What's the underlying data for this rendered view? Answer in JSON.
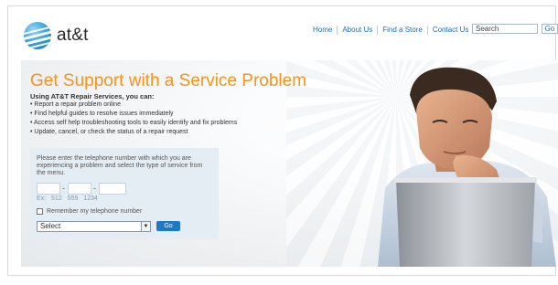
{
  "header": {
    "logo_text": "at&t",
    "nav": [
      "Home",
      "About Us",
      "Find a Store",
      "Contact Us"
    ],
    "search_value": "Search",
    "search_go": "Go"
  },
  "hero": {
    "headline": "Get Support with a Service Problem",
    "subhead": "Using AT&T Repair Services, you can:",
    "bullets": [
      "Report a repair problem online",
      "Find helpful guides to resolve issues immediately",
      "Access self help troubleshooting tools to easily identify and fix problems",
      "Update, cancel, or check the status of a repair request"
    ]
  },
  "form": {
    "instructions": "Please enter the telephone number with which you are experiencing a problem and select the type of service from the menu.",
    "dash": "-",
    "hint": "Ex: 512  555  1234",
    "remember_label": "Remember my telephone number",
    "select_value": "Select",
    "go_label": "Go"
  },
  "colors": {
    "accent_orange": "#f7931d",
    "link_blue": "#1a6fb4",
    "button_blue": "#1e78c2",
    "panel_bg": "#e4ecf4"
  }
}
